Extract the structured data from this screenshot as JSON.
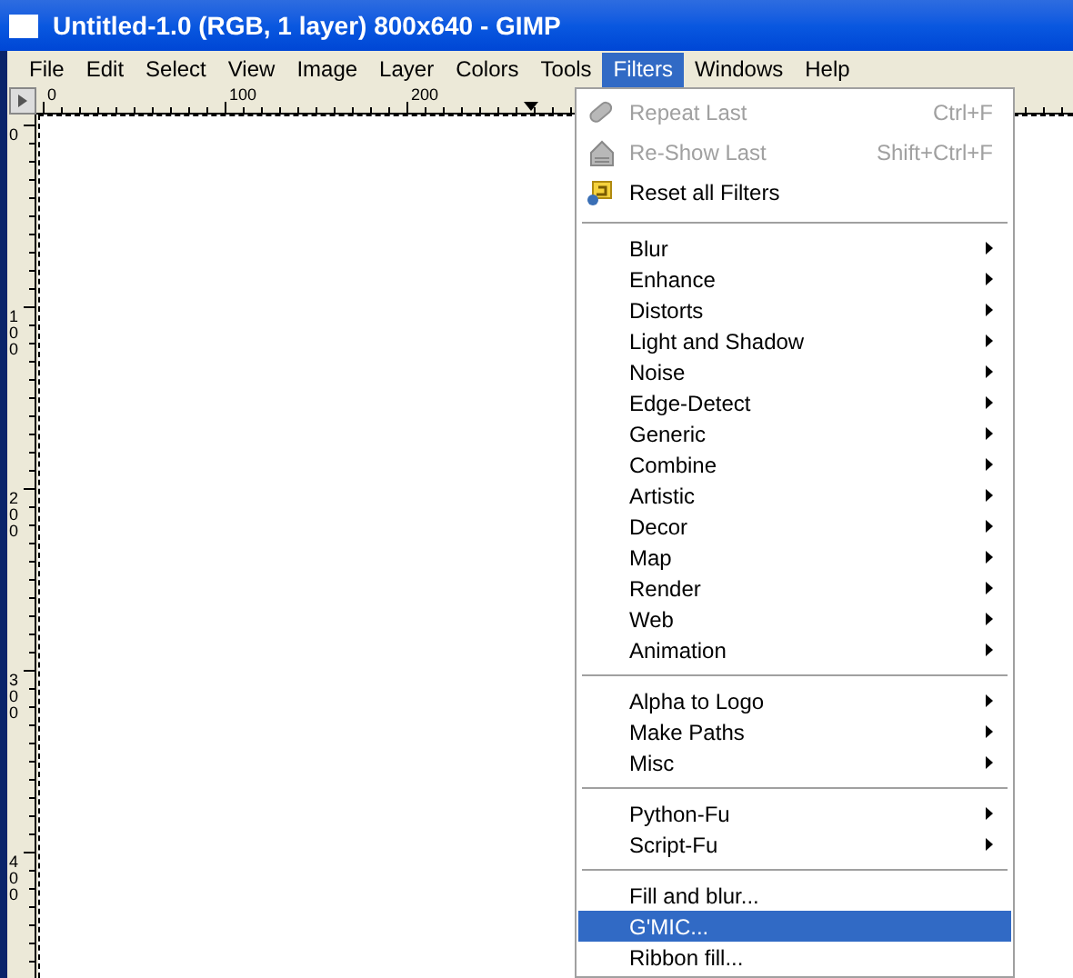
{
  "window": {
    "title": "Untitled-1.0 (RGB, 1 layer) 800x640 - GIMP"
  },
  "menubar": [
    {
      "label": "File",
      "selected": false
    },
    {
      "label": "Edit",
      "selected": false
    },
    {
      "label": "Select",
      "selected": false
    },
    {
      "label": "View",
      "selected": false
    },
    {
      "label": "Image",
      "selected": false
    },
    {
      "label": "Layer",
      "selected": false
    },
    {
      "label": "Colors",
      "selected": false
    },
    {
      "label": "Tools",
      "selected": false
    },
    {
      "label": "Filters",
      "selected": true
    },
    {
      "label": "Windows",
      "selected": false
    },
    {
      "label": "Help",
      "selected": false
    }
  ],
  "top_ruler": {
    "labels": [
      "0",
      "100",
      "200"
    ]
  },
  "left_ruler": {
    "labels": [
      "0",
      "100",
      "200",
      "300",
      "400"
    ]
  },
  "filters_menu": {
    "sections": [
      [
        {
          "label": "Repeat Last",
          "shortcut": "Ctrl+F",
          "disabled": true,
          "submenu": false,
          "selected": false
        },
        {
          "label": "Re-Show Last",
          "shortcut": "Shift+Ctrl+F",
          "disabled": true,
          "submenu": false,
          "selected": false
        },
        {
          "label": "Reset all Filters",
          "disabled": false,
          "submenu": false,
          "selected": false
        }
      ],
      [
        {
          "label": "Blur",
          "disabled": false,
          "submenu": true,
          "selected": false
        },
        {
          "label": "Enhance",
          "disabled": false,
          "submenu": true,
          "selected": false
        },
        {
          "label": "Distorts",
          "disabled": false,
          "submenu": true,
          "selected": false
        },
        {
          "label": "Light and Shadow",
          "disabled": false,
          "submenu": true,
          "selected": false
        },
        {
          "label": "Noise",
          "disabled": false,
          "submenu": true,
          "selected": false
        },
        {
          "label": "Edge-Detect",
          "disabled": false,
          "submenu": true,
          "selected": false
        },
        {
          "label": "Generic",
          "disabled": false,
          "submenu": true,
          "selected": false
        },
        {
          "label": "Combine",
          "disabled": false,
          "submenu": true,
          "selected": false
        },
        {
          "label": "Artistic",
          "disabled": false,
          "submenu": true,
          "selected": false
        },
        {
          "label": "Decor",
          "disabled": false,
          "submenu": true,
          "selected": false
        },
        {
          "label": "Map",
          "disabled": false,
          "submenu": true,
          "selected": false
        },
        {
          "label": "Render",
          "disabled": false,
          "submenu": true,
          "selected": false
        },
        {
          "label": "Web",
          "disabled": false,
          "submenu": true,
          "selected": false
        },
        {
          "label": "Animation",
          "disabled": false,
          "submenu": true,
          "selected": false
        }
      ],
      [
        {
          "label": "Alpha to Logo",
          "disabled": false,
          "submenu": true,
          "selected": false
        },
        {
          "label": "Make Paths",
          "disabled": false,
          "submenu": true,
          "selected": false
        },
        {
          "label": "Misc",
          "disabled": false,
          "submenu": true,
          "selected": false
        }
      ],
      [
        {
          "label": "Python-Fu",
          "disabled": false,
          "submenu": true,
          "selected": false
        },
        {
          "label": "Script-Fu",
          "disabled": false,
          "submenu": true,
          "selected": false
        }
      ],
      [
        {
          "label": "Fill and blur...",
          "disabled": false,
          "submenu": false,
          "selected": false
        },
        {
          "label": "G'MIC...",
          "disabled": false,
          "submenu": false,
          "selected": true
        },
        {
          "label": "Ribbon fill...",
          "disabled": false,
          "submenu": false,
          "selected": false
        }
      ]
    ]
  }
}
